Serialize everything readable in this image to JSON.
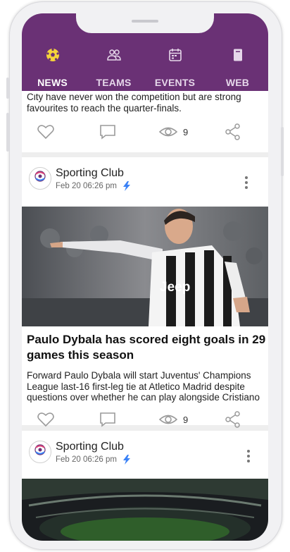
{
  "tabs": [
    {
      "label": "NEWS",
      "icon": "soccer-ball-icon",
      "active": true
    },
    {
      "label": "TEAMS",
      "icon": "people-icon",
      "active": false
    },
    {
      "label": "EVENTS",
      "icon": "calendar-icon",
      "active": false
    },
    {
      "label": "WEB",
      "icon": "book-icon",
      "active": false
    }
  ],
  "post0": {
    "excerpt_line1": "City have never won the competition but are strong",
    "excerpt_line2": "favourites to reach the quarter-finals.",
    "views": "9"
  },
  "post1": {
    "author": "Sporting Club",
    "date": "Feb 20 06:26 pm",
    "image": "football-player-pointing-photo",
    "title_line1": "Paulo Dybala has scored eight goals in 29",
    "title_line2": "games this season",
    "excerpt_line1": "Forward Paulo Dybala will start Juventus' Champions",
    "excerpt_line2": "League last-16 first-leg tie at Atletico Madrid despite",
    "excerpt_line3": "questions over whether he can play alongside Cristiano",
    "views": "9",
    "jersey_text": "Jeep"
  },
  "post2": {
    "author": "Sporting Club",
    "date": "Feb 20 06:26 pm",
    "image": "stadium-photo"
  },
  "colors": {
    "brand": "#6a3175",
    "accent": "#3b82f6"
  }
}
